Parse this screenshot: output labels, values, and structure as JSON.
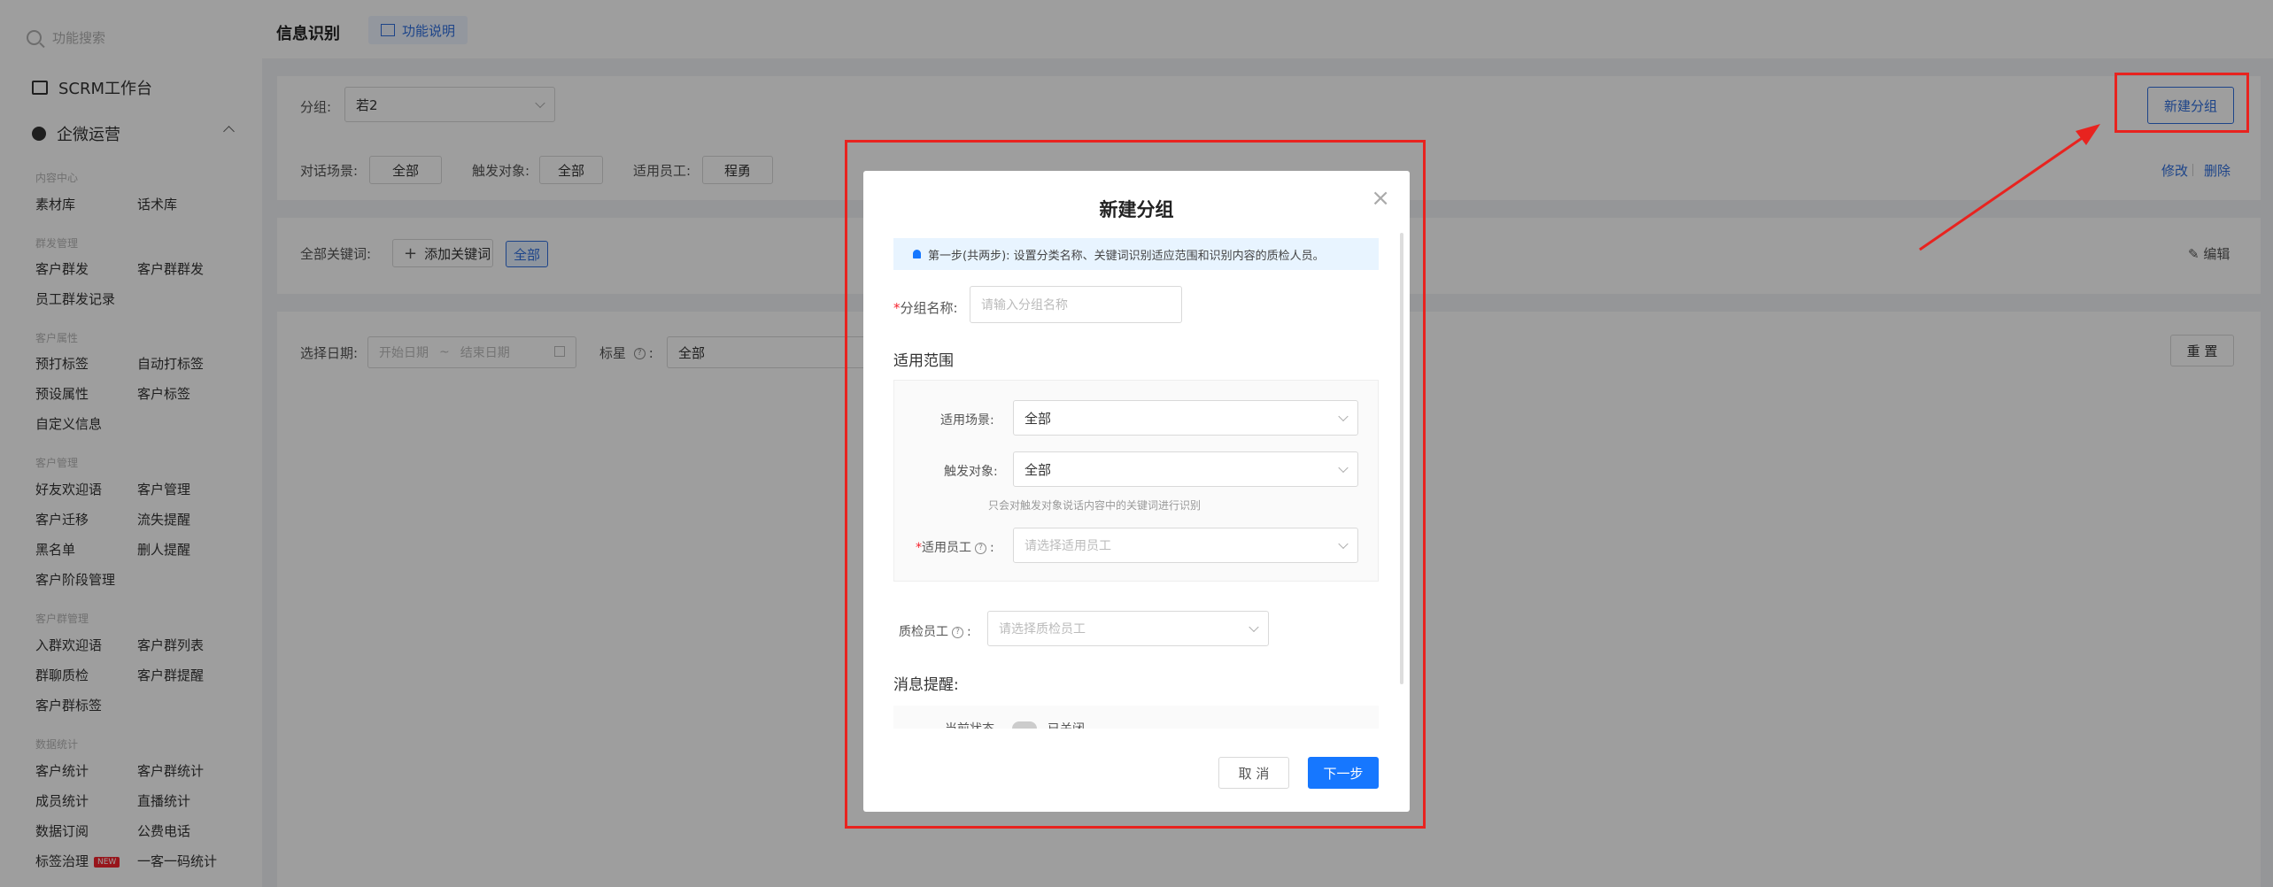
{
  "colors": {
    "accent": "#1677ff",
    "annotation": "#e8231f"
  },
  "sidebar": {
    "search_placeholder": "功能搜索",
    "workbench": "SCRM工作台",
    "ops": "企微运营",
    "groups": [
      {
        "title": "内容中心",
        "items": [
          "素材库",
          "话术库"
        ]
      },
      {
        "title": "群发管理",
        "items": [
          "客户群发",
          "客户群群发",
          "员工群发记录"
        ]
      },
      {
        "title": "客户属性",
        "items": [
          "预打标签",
          "自动打标签",
          "预设属性",
          "客户标签",
          "自定义信息"
        ]
      },
      {
        "title": "客户管理",
        "items": [
          "好友欢迎语",
          "客户管理",
          "客户迁移",
          "流失提醒",
          "黑名单",
          "删人提醒",
          "客户阶段管理"
        ]
      },
      {
        "title": "客户群管理",
        "items": [
          "入群欢迎语",
          "客户群列表",
          "群聊质检",
          "客户群提醒",
          "客户群标签"
        ]
      },
      {
        "title": "数据统计",
        "items": [
          "客户统计",
          "客户群统计",
          "成员统计",
          "直播统计",
          "数据订阅",
          "公费电话",
          "标签治理",
          "一客一码统计"
        ]
      }
    ],
    "new_badge": "NEW"
  },
  "header": {
    "title": "信息识别",
    "help": "功能说明"
  },
  "filters": {
    "group_label": "分组:",
    "group_value": "若2",
    "new_group_button": "新建分组",
    "scene_label": "对话场景:",
    "scene_value": "全部",
    "trigger_label": "触发对象:",
    "trigger_value": "全部",
    "staff_label": "适用员工:",
    "staff_value": "程勇",
    "edit_link": "修改",
    "delete_link": "删除",
    "keywords_label": "全部关键词:",
    "add_keyword": "添加关键词",
    "keyword_tag": "全部",
    "edit_keywords": "编辑",
    "date_label": "选择日期:",
    "start_date": "开始日期",
    "end_date": "结束日期",
    "mark_label": "标星",
    "mark_value": "全部",
    "reset_button": "重 置"
  },
  "modal": {
    "title": "新建分组",
    "tip": "第一步(共两步): 设置分类名称、关键词识别适应范围和识别内容的质检人员。",
    "name_label": "分组名称:",
    "name_placeholder": "请输入分组名称",
    "scope_title": "适用范围",
    "scene_label": "适用场景:",
    "scene_value": "全部",
    "trigger_label": "触发对象:",
    "trigger_value": "全部",
    "trigger_hint": "只会对触发对象说话内容中的关键词进行识别",
    "staff_label": "适用员工",
    "staff_placeholder": "请选择适用员工",
    "qc_label": "质检员工",
    "qc_placeholder": "请选择质检员工",
    "notify_title": "消息提醒:",
    "notify_row_label": "当前状态",
    "notify_status": "已关闭",
    "cancel": "取 消",
    "next": "下一步"
  }
}
